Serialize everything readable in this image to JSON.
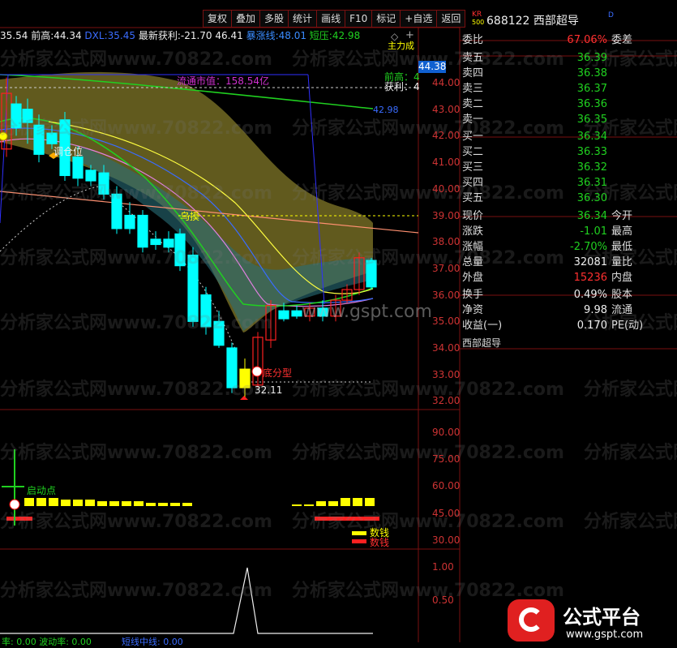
{
  "toolbar": {
    "buttons": [
      "复权",
      "叠加",
      "多股",
      "统计",
      "画线",
      "F10",
      "标记",
      "+自选",
      "返回"
    ]
  },
  "infobar": {
    "first": "35.54",
    "qiangao_label": "前高:",
    "qiangao": "44.34",
    "dxl_label": "DXL:",
    "dxl": "35.45",
    "zuixin_label": "最新获利:",
    "zuixin": "-21.70",
    "zuixin2": "46.41",
    "baozhang_label": "暴涨线:",
    "baozhang": "48.01",
    "duanya_label": "短压:",
    "duanya": "42.98",
    "right_clip": "主力成"
  },
  "price_axis": [
    "44.00",
    "43.00",
    "42.00",
    "41.00",
    "40.00",
    "39.00",
    "38.00",
    "37.00",
    "36.00",
    "35.00",
    "34.00",
    "33.00",
    "32.00"
  ],
  "price_current": "44.38",
  "indicator_axis": [
    "90.00",
    "75.00",
    "60.00",
    "45.00",
    "30.00"
  ],
  "bottom_axis": [
    "1.00",
    "0.50"
  ],
  "chart_labels": {
    "liutong": "流通市值：158.54亿",
    "qiangao_mark": "前高：4",
    "huoli_mark": "获利：4",
    "line_4298": "42.98",
    "tiaowei": "调仓位",
    "wutan": "乌摸",
    "difen": "底分型",
    "low": "32.11",
    "qidong": "启动点",
    "shuqian1": "数钱",
    "shuqian2": "数钱",
    "bottom_left": "率: 0.00  波动率: 0.00",
    "bottom_mid": "短线中线: 0.00",
    "gspt": "www.gspt.com"
  },
  "stock": {
    "kr": "KR",
    "sub": "500",
    "code_name": "688122 西部超导",
    "sup": "D"
  },
  "order_book": {
    "weibi_label": "委比",
    "weibi": "67.06%",
    "weicha_label": "委差",
    "asks": [
      {
        "label": "卖五",
        "price": "36.39"
      },
      {
        "label": "卖四",
        "price": "36.38"
      },
      {
        "label": "卖三",
        "price": "36.37"
      },
      {
        "label": "卖二",
        "price": "36.36"
      },
      {
        "label": "卖一",
        "price": "36.35"
      }
    ],
    "bids": [
      {
        "label": "买一",
        "price": "36.34"
      },
      {
        "label": "买二",
        "price": "36.33"
      },
      {
        "label": "买三",
        "price": "36.32"
      },
      {
        "label": "买四",
        "price": "36.31"
      },
      {
        "label": "买五",
        "price": "36.30"
      }
    ]
  },
  "quote": [
    {
      "label": "现价",
      "value": "36.34",
      "label2": "今开",
      "color": "#20d020"
    },
    {
      "label": "涨跌",
      "value": "-1.01",
      "label2": "最高",
      "color": "#20d020"
    },
    {
      "label": "涨幅",
      "value": "-2.70%",
      "label2": "最低",
      "color": "#20d020"
    },
    {
      "label": "总量",
      "value": "32081",
      "label2": "量比",
      "color": "#eeeeee"
    },
    {
      "label": "外盘",
      "value": "15236",
      "label2": "内盘",
      "color": "#ff3030"
    }
  ],
  "quote2": [
    {
      "label": "换手",
      "value": "0.49%",
      "label2": "股本"
    },
    {
      "label": "净资",
      "value": "9.98",
      "label2": "流通"
    },
    {
      "label": "收益(一)",
      "value": "0.170",
      "label2": "PE(动)"
    }
  ],
  "bottom_panel_title": "西部超导",
  "logo": {
    "text": "公式平台",
    "url": "www.gspt.com"
  },
  "watermark": "分析家公式网www.70822.com",
  "colors": {
    "up": "#ff2020",
    "down": "#00ffff",
    "grid": "#7a1010",
    "yellow": "#ffff00",
    "green": "#20d020"
  }
}
